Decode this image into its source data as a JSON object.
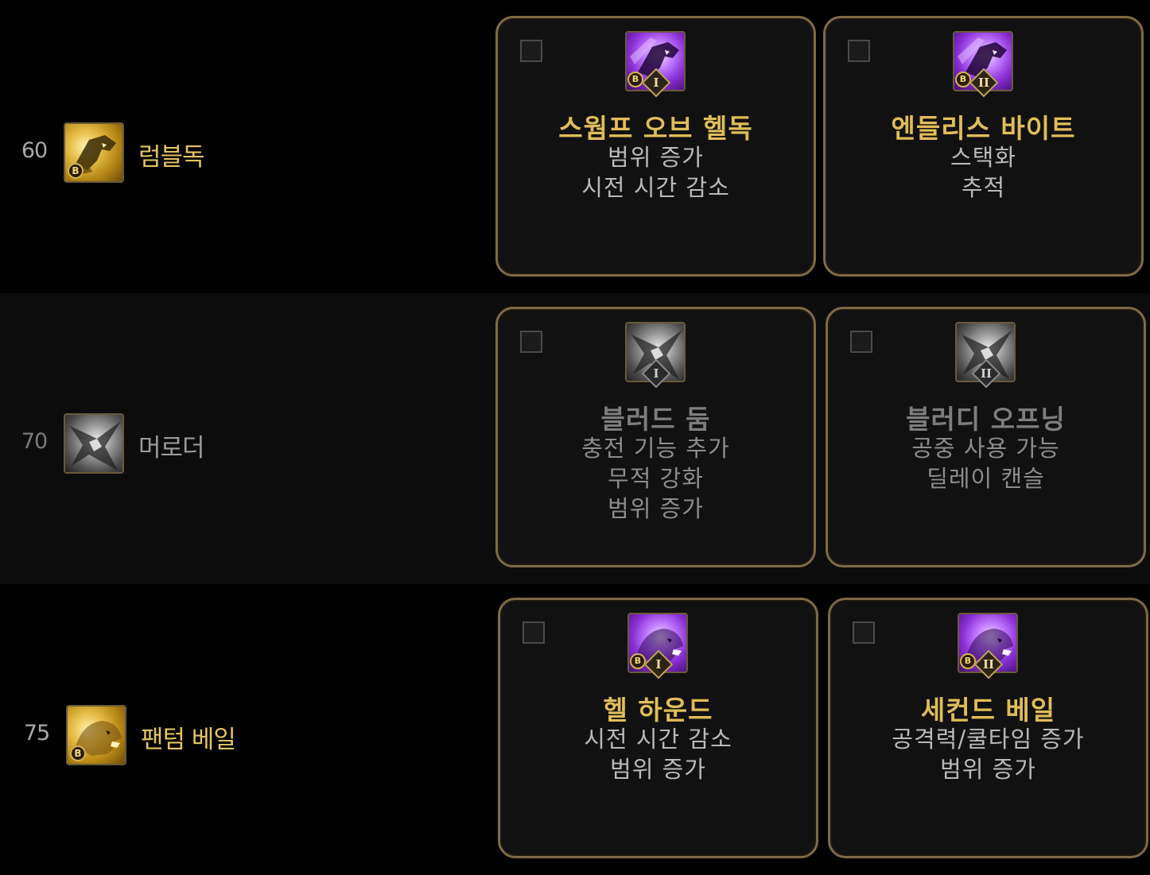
{
  "rows": [
    {
      "level": "60",
      "base_skill": {
        "name": "럼블독",
        "icon": "hound-gold-icon",
        "badge": "B"
      },
      "options": [
        {
          "tier": "I",
          "badge": "B",
          "icon": "hound-purple-icon",
          "title": "스웜프 오브 헬독",
          "effects": [
            "범위 증가",
            "시전 시간 감소"
          ]
        },
        {
          "tier": "II",
          "badge": "B",
          "icon": "hound-purple-icon",
          "title": "엔들리스 바이트",
          "effects": [
            "스택화",
            "추적"
          ]
        }
      ]
    },
    {
      "level": "70",
      "base_skill": {
        "name": "머로더",
        "icon": "marauder-grey-icon"
      },
      "options": [
        {
          "tier": "I",
          "icon": "marauder-grey-icon",
          "title": "블러드 둠",
          "effects": [
            "충전 기능 추가",
            "무적 강화",
            "범위 증가"
          ]
        },
        {
          "tier": "II",
          "icon": "marauder-grey-icon",
          "title": "블러디 오프닝",
          "effects": [
            "공중 사용 가능",
            "딜레이 캔슬"
          ]
        }
      ]
    },
    {
      "level": "75",
      "base_skill": {
        "name": "팬텀 베일",
        "icon": "beast-gold-icon",
        "badge": "B"
      },
      "options": [
        {
          "tier": "I",
          "badge": "B",
          "icon": "beast-purple-icon",
          "title": "헬 하운드",
          "effects": [
            "시전 시간 감소",
            "범위 증가"
          ]
        },
        {
          "tier": "II",
          "badge": "B",
          "icon": "beast-purple-icon",
          "title": "세컨드 베일",
          "effects": [
            "공격력/쿨타임 증가",
            "범위 증가"
          ]
        }
      ]
    }
  ],
  "colors": {
    "gold_text": "#e0bd58",
    "dim_text": "#7d7d7d",
    "card_border": "#7e6a46"
  }
}
